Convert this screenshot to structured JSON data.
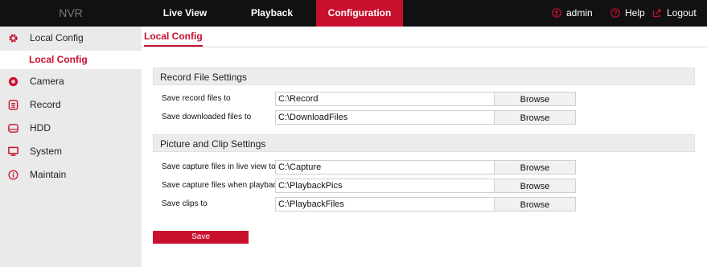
{
  "brand": "NVR",
  "nav": {
    "live_view": "Live View",
    "playback": "Playback",
    "configuration": "Configuration"
  },
  "top_actions": {
    "user": "admin",
    "help": "Help",
    "logout": "Logout"
  },
  "sidebar": {
    "items": [
      {
        "label": "Local Config",
        "icon": "gear-icon"
      },
      {
        "label": "Camera",
        "icon": "camera-icon"
      },
      {
        "label": "Record",
        "icon": "record-icon"
      },
      {
        "label": "HDD",
        "icon": "hdd-icon"
      },
      {
        "label": "System",
        "icon": "monitor-icon"
      },
      {
        "label": "Maintain",
        "icon": "info-icon"
      }
    ],
    "sub_item": "Local Config"
  },
  "page_tab": "Local Config",
  "sections": {
    "record": {
      "title": "Record File Settings",
      "rows": [
        {
          "label": "Save record files to",
          "value": "C:\\Record",
          "button": "Browse"
        },
        {
          "label": "Save downloaded files to",
          "value": "C:\\DownloadFiles",
          "button": "Browse"
        }
      ]
    },
    "picture": {
      "title": "Picture and Clip Settings",
      "rows": [
        {
          "label": "Save capture files in live view to",
          "value": "C:\\Capture",
          "button": "Browse"
        },
        {
          "label": "Save capture files when playback to",
          "value": "C:\\PlaybackPics",
          "button": "Browse"
        },
        {
          "label": "Save clips to",
          "value": "C:\\PlaybackFiles",
          "button": "Browse"
        }
      ]
    }
  },
  "save_label": "Save",
  "colors": {
    "accent": "#c8102e",
    "topbar": "#111111",
    "sidebar": "#eaeaea"
  }
}
